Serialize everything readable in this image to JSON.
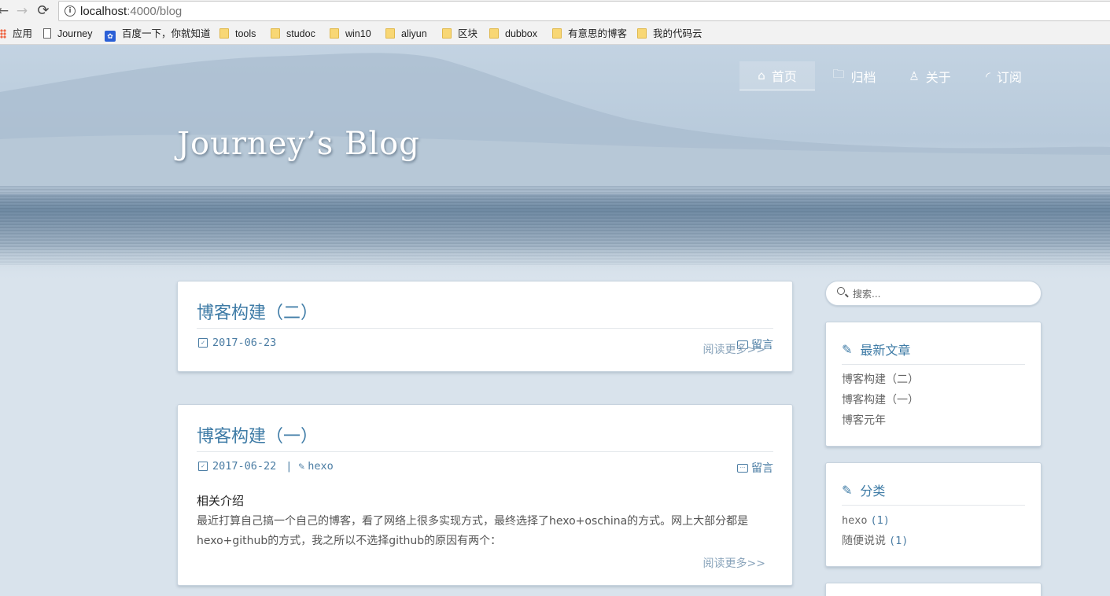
{
  "browser": {
    "url_host": "localhost",
    "url_path": ":4000/blog",
    "bookmarks": [
      {
        "label": "应用",
        "icon": "apps-grid-icon"
      },
      {
        "label": "Journey",
        "icon": "page-icon"
      },
      {
        "label": "百度一下，你就知道",
        "icon": "baidu-paw-icon"
      },
      {
        "label": "tools",
        "icon": "folder-icon"
      },
      {
        "label": "studoc",
        "icon": "folder-icon"
      },
      {
        "label": "win10",
        "icon": "folder-icon"
      },
      {
        "label": "aliyun",
        "icon": "folder-icon"
      },
      {
        "label": "区块",
        "icon": "folder-icon"
      },
      {
        "label": "dubbox",
        "icon": "folder-icon"
      },
      {
        "label": "有意思的博客",
        "icon": "folder-icon"
      },
      {
        "label": "我的代码云",
        "icon": "folder-icon"
      }
    ]
  },
  "site": {
    "title": "Journey’s Blog",
    "nav": [
      {
        "label": "首页",
        "icon": "home-icon",
        "active": true
      },
      {
        "label": "归档",
        "icon": "folder-icon",
        "active": false
      },
      {
        "label": "关于",
        "icon": "user-icon",
        "active": false
      },
      {
        "label": "订阅",
        "icon": "rss-icon",
        "active": false
      }
    ]
  },
  "posts": [
    {
      "title": "博客构建（二）",
      "date": "2017-06-23",
      "comments_label": "留言",
      "read_more": "阅读更多>>"
    },
    {
      "title": "博客构建（一）",
      "date": "2017-06-22",
      "tag": "hexo",
      "comments_label": "留言",
      "excerpt_heading": "相关介绍",
      "excerpt": "最近打算自己搞一个自己的博客，看了网络上很多实现方式，最终选择了hexo+oschina的方式。网上大部分都是hexo+github的方式，我之所以不选择github的原因有两个：",
      "read_more": "阅读更多>>"
    }
  ],
  "sidebar": {
    "search_placeholder": "搜索...",
    "recent": {
      "title": "最新文章",
      "items": [
        "博客构建（二）",
        "博客构建（一）",
        "博客元年"
      ]
    },
    "categories": {
      "title": "分类",
      "items": [
        {
          "name": "hexo",
          "count": "(1)"
        },
        {
          "name": "随便说说",
          "count": "(1)"
        }
      ]
    }
  },
  "colors": {
    "accent": "#3e7ba6",
    "page_bg": "#d9e3ec"
  }
}
